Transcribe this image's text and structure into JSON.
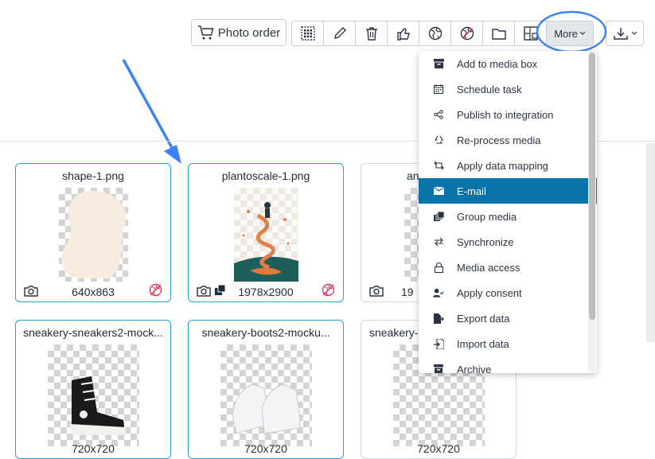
{
  "toolbar": {
    "photo_order_label": "Photo order",
    "more_label": "More"
  },
  "cards": [
    {
      "name": "shape-1.png",
      "dims": "640x863"
    },
    {
      "name": "plantoscale-1.png",
      "dims": "1978x2900"
    },
    {
      "name": "an",
      "dims": "19"
    },
    {
      "name": "sneakery-sneakers2-mock...",
      "dims": "720x720"
    },
    {
      "name": "sneakery-boots2-mocku...",
      "dims": "720x720"
    },
    {
      "name": "sneakery-",
      "dims": "720x720"
    }
  ],
  "menu": {
    "items": [
      {
        "label": "Add to media box",
        "icon": "box-icon"
      },
      {
        "label": "Schedule task",
        "icon": "calendar-icon"
      },
      {
        "label": "Publish to integration",
        "icon": "share-icon"
      },
      {
        "label": "Re-process media",
        "icon": "recycle-icon"
      },
      {
        "label": "Apply data mapping",
        "icon": "mapping-icon"
      },
      {
        "label": "E-mail",
        "icon": "envelope-icon",
        "active": true
      },
      {
        "label": "Group media",
        "icon": "group-icon"
      },
      {
        "label": "Synchronize",
        "icon": "sync-icon"
      },
      {
        "label": "Media access",
        "icon": "lock-icon"
      },
      {
        "label": "Apply consent",
        "icon": "user-consent-icon"
      },
      {
        "label": "Export data",
        "icon": "export-icon"
      },
      {
        "label": "Import data",
        "icon": "import-icon"
      },
      {
        "label": "Archive",
        "icon": "archive-icon"
      }
    ]
  },
  "colors": {
    "accent": "#0a73a8",
    "card_border": "#2aa0c8",
    "annotation": "#3b82f6",
    "globe_red": "#e03a5a"
  }
}
